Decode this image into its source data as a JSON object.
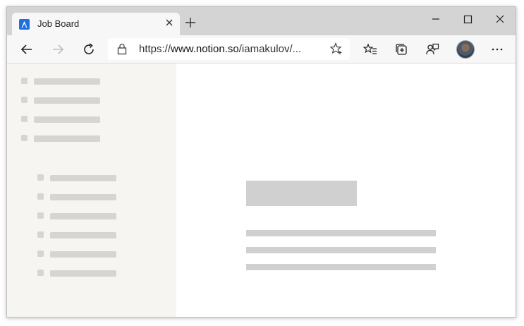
{
  "tab": {
    "title": "Job Board"
  },
  "address_bar": {
    "url_prefix": "https://",
    "url_host": "www.notion.so",
    "url_rest": "/iamakulov/..."
  },
  "icons": {
    "back": "back-arrow-icon",
    "forward": "forward-arrow-icon",
    "refresh": "refresh-icon",
    "lock": "lock-icon",
    "favorite": "star-plus-icon",
    "favorites_list": "favorites-icon",
    "collections": "collections-icon",
    "feedback": "feedback-icon",
    "more": "more-dots-icon"
  },
  "colors": {
    "favicon": "#1f6fe0",
    "skeleton": "#d0d0d0",
    "sidebar_bg": "#f6f5f2"
  }
}
